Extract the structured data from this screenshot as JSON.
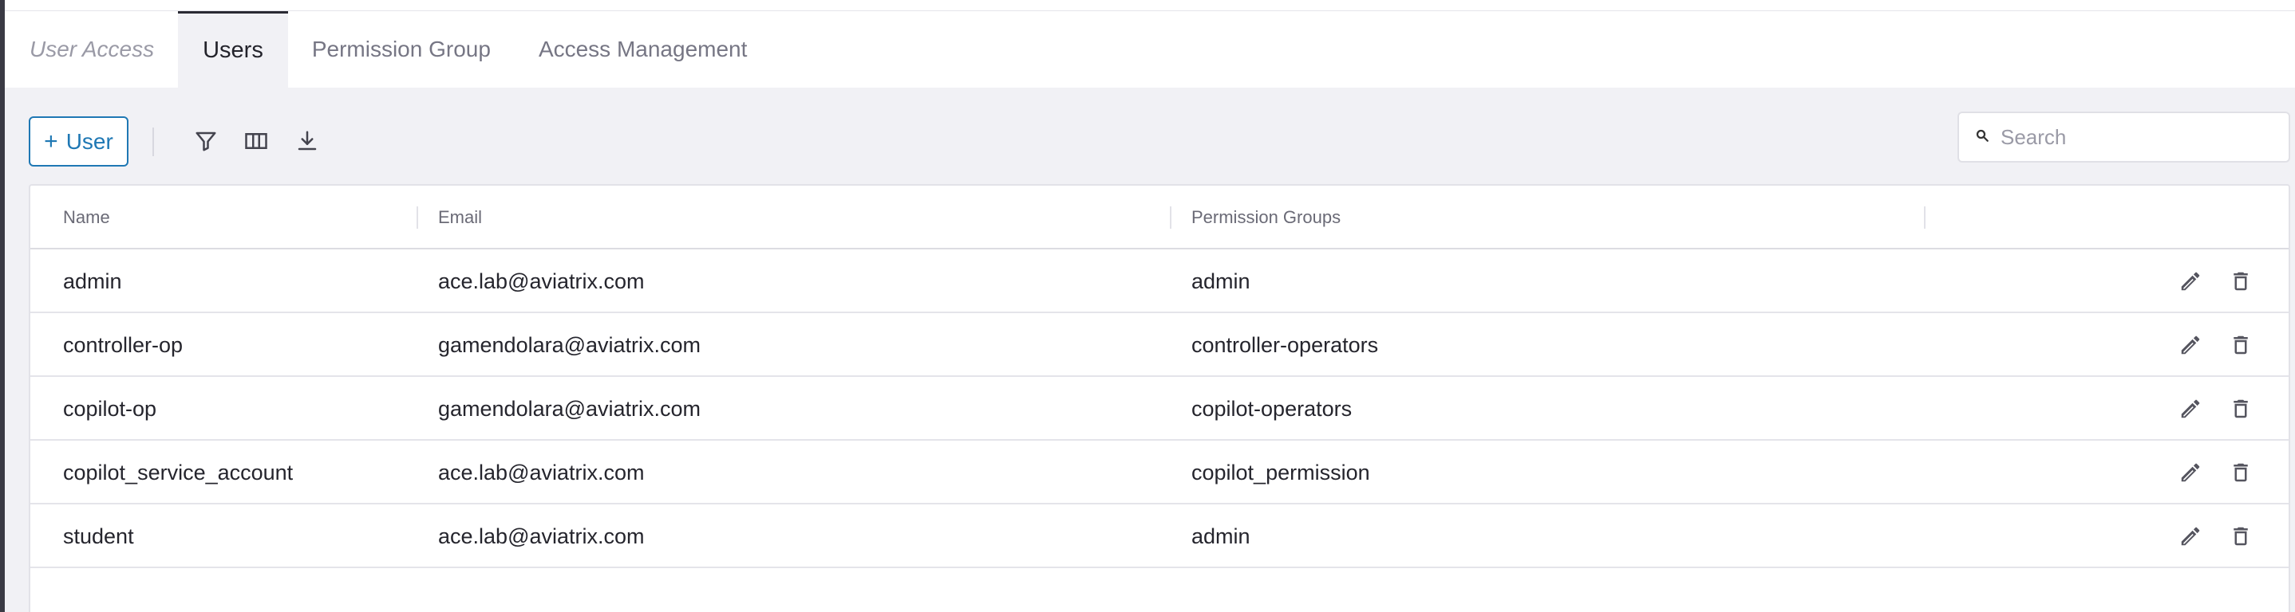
{
  "tabs": [
    {
      "label": "User Access"
    },
    {
      "label": "Users"
    },
    {
      "label": "Permission Group"
    },
    {
      "label": "Access Management"
    }
  ],
  "active_tab": "Users",
  "toolbar": {
    "add_user_label": "User",
    "add_user_icon": "plus-icon",
    "tools": [
      "filter-icon",
      "columns-icon",
      "download-icon"
    ]
  },
  "search": {
    "placeholder": "Search",
    "value": ""
  },
  "table": {
    "columns": [
      "Name",
      "Email",
      "Permission Groups"
    ],
    "rows": [
      {
        "name": "admin",
        "email": "ace.lab@aviatrix.com",
        "groups": "admin"
      },
      {
        "name": "controller-op",
        "email": "gamendolara@aviatrix.com",
        "groups": "controller-operators"
      },
      {
        "name": "copilot-op",
        "email": "gamendolara@aviatrix.com",
        "groups": "copilot-operators"
      },
      {
        "name": "copilot_service_account",
        "email": "ace.lab@aviatrix.com",
        "groups": "copilot_permission"
      },
      {
        "name": "student",
        "email": "ace.lab@aviatrix.com",
        "groups": "admin"
      }
    ],
    "row_actions": [
      "edit-icon",
      "delete-icon"
    ]
  },
  "colors": {
    "accent": "#1f78b4",
    "content_bg": "#f1f1f5",
    "active_tab_border": "#2a2a33"
  }
}
